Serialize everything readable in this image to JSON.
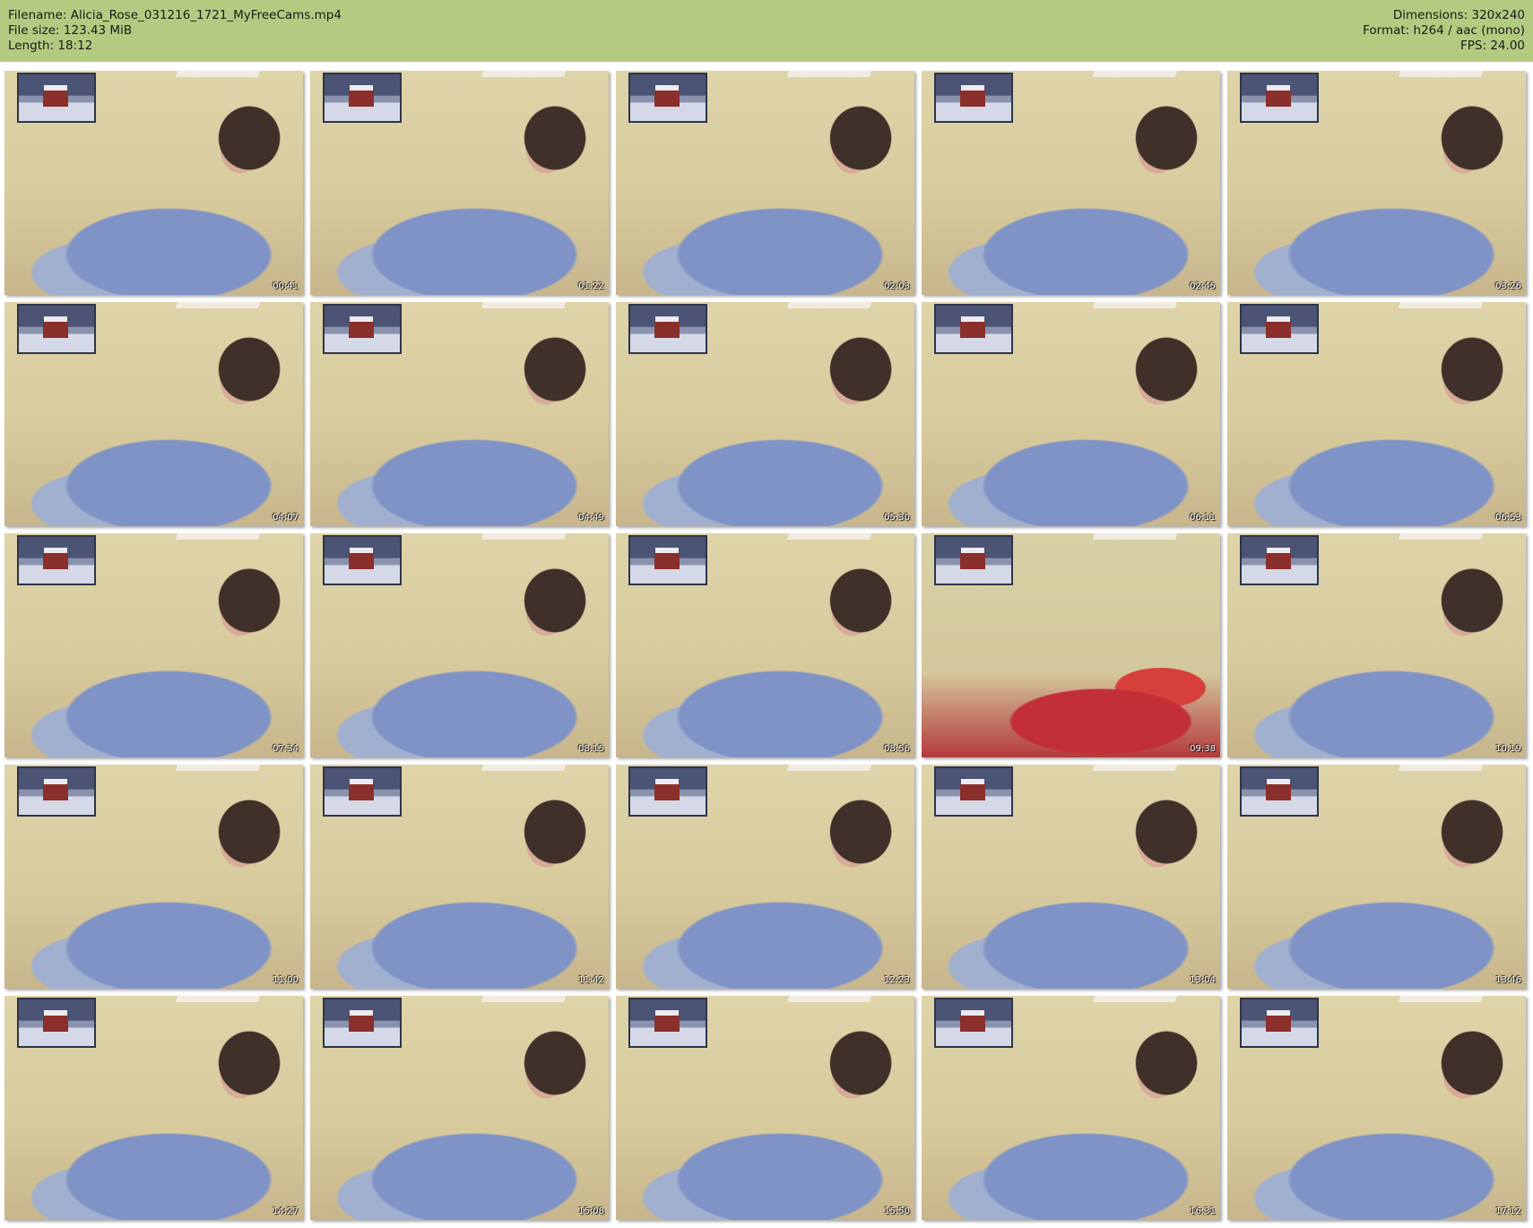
{
  "header": {
    "filename": "Filename: Alicia_Rose_031216_1721_MyFreeCams.mp4",
    "file_size": "File size: 123.43 MiB",
    "length": "Length: 18:12",
    "dimensions": "Dimensions: 320x240",
    "format": "Format: h264 / aac (mono)",
    "fps": "FPS: 24.00"
  },
  "thumbnails": [
    "00:41",
    "01:22",
    "02:03",
    "02:45",
    "03:26",
    "04:07",
    "04:49",
    "05:30",
    "06:11",
    "06:53",
    "07:34",
    "08:15",
    "08:56",
    "09:38",
    "10:19",
    "11:00",
    "11:42",
    "12:23",
    "13:04",
    "13:46",
    "14:27",
    "15:08",
    "15:50",
    "16:31",
    "17:12"
  ],
  "colors": {
    "header_background": "#b2cb80",
    "page_background": "#ffffff",
    "timestamp_text": "#ffffff"
  }
}
